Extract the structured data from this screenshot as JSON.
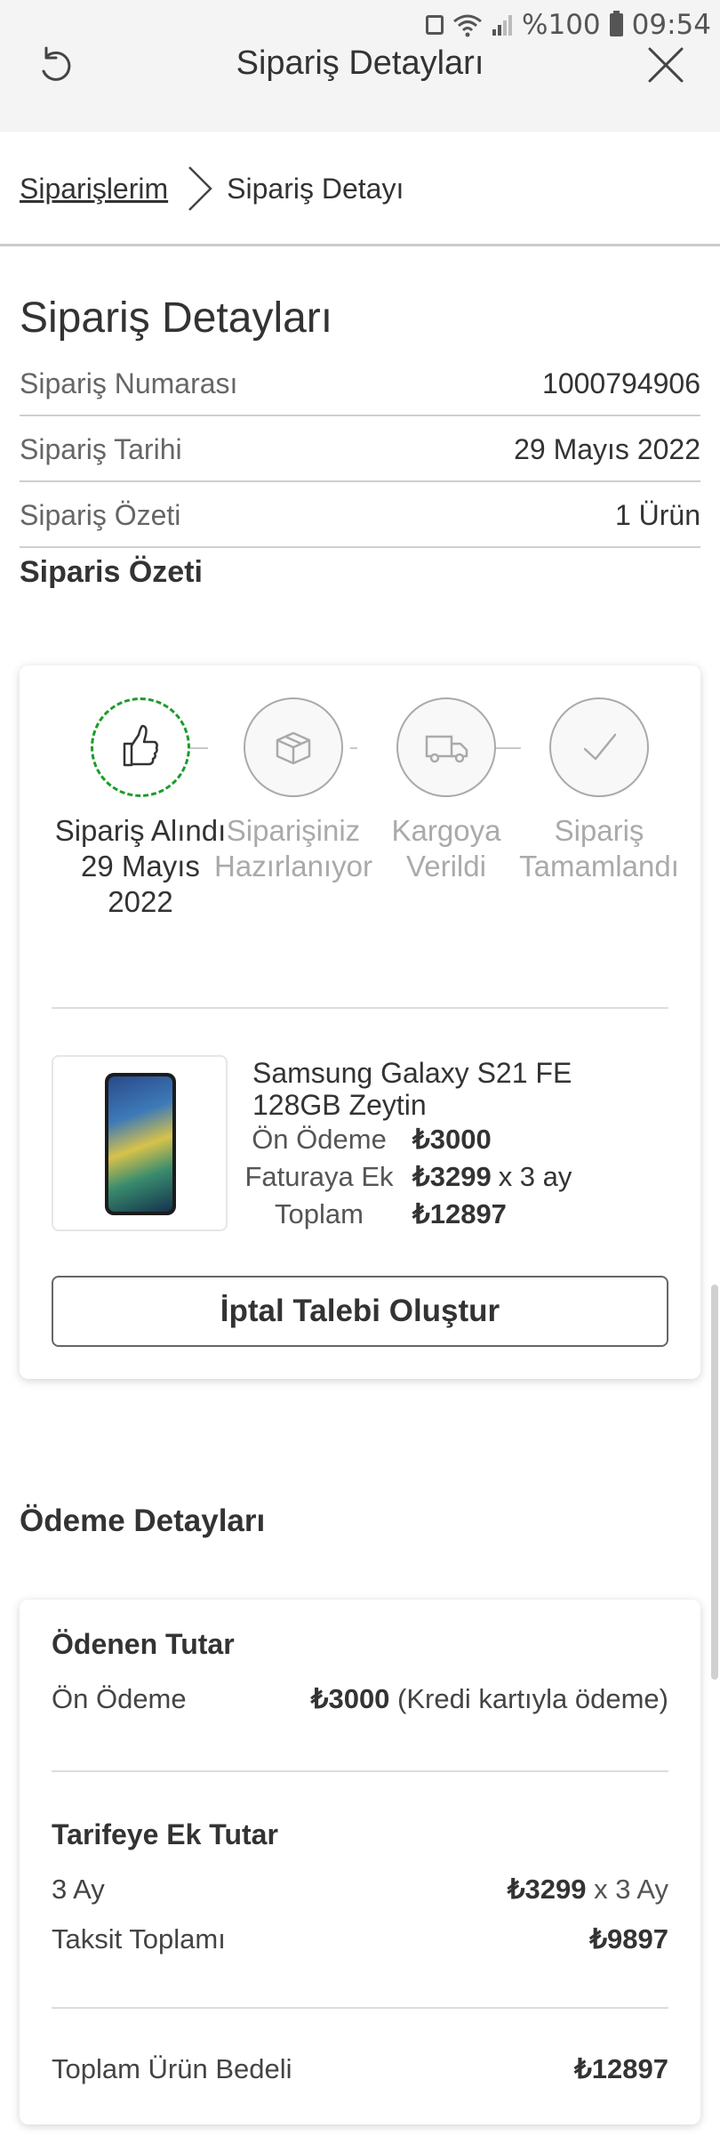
{
  "status_bar": {
    "battery": "%100",
    "time": "09:54"
  },
  "header": {
    "title": "Sipariş Detayları"
  },
  "breadcrumb": {
    "parent": "Siparişlerim",
    "current": "Sipariş Detayı"
  },
  "order_details": {
    "title": "Sipariş Detayları",
    "rows": [
      {
        "label": "Sipariş Numarası",
        "value": "1000794906"
      },
      {
        "label": "Sipariş Tarihi",
        "value": "29 Mayıs 2022"
      },
      {
        "label": "Sipariş Özeti",
        "value": "1 Ürün"
      }
    ]
  },
  "order_summary": {
    "title": "Siparis Özeti",
    "steps": [
      {
        "label": "Sipariş Alındı 29 Mayıs 2022",
        "icon": "thumbs-up-icon",
        "active": true
      },
      {
        "label": "Siparişiniz Hazırlanıyor",
        "icon": "box-icon",
        "active": false
      },
      {
        "label": "Kargoya Verildi",
        "icon": "truck-icon",
        "active": false
      },
      {
        "label": "Sipariş Tamamlandı",
        "icon": "check-icon",
        "active": false
      }
    ],
    "product": {
      "name": "Samsung Galaxy S21 FE",
      "variant": "128GB Zeytin",
      "prices": [
        {
          "label": "Ön Ödeme",
          "value": "₺3000",
          "suffix": ""
        },
        {
          "label": "Faturaya Ek",
          "value": "₺3299",
          "suffix": "x 3 ay"
        },
        {
          "label": "Toplam",
          "value": "₺12897",
          "suffix": ""
        }
      ]
    },
    "cancel_button": "İptal Talebi Oluştur"
  },
  "payment_details": {
    "title": "Ödeme Detayları",
    "paid_heading": "Ödenen Tutar",
    "down_payment_label": "Ön Ödeme",
    "down_payment_value": "₺3000",
    "down_payment_note": "(Kredi kartıyla ödeme)",
    "tariff_heading": "Tarifeye Ek Tutar",
    "months_label": "3 Ay",
    "monthly_value": "₺3299",
    "monthly_suffix": "x 3 Ay",
    "installment_label": "Taksit Toplamı",
    "installment_value": "₺9897",
    "total_label": "Toplam Ürün Bedeli",
    "total_value": "₺12897"
  },
  "colors": {
    "active_step": "#1a9c2a",
    "inactive_step": "#aaaaaa",
    "header_bg": "#f4f4f4"
  }
}
